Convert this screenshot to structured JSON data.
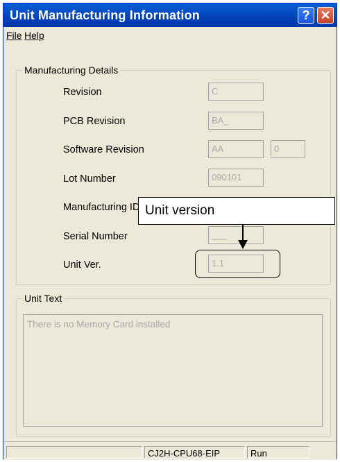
{
  "window": {
    "title": "Unit Manufacturing Information"
  },
  "title_buttons": {
    "help_glyph": "?",
    "close_glyph": "✕"
  },
  "menu": {
    "file": "File",
    "help": "Help"
  },
  "manufacturing_details": {
    "legend": "Manufacturing Details",
    "revision_label": "Revision",
    "revision_value": "C",
    "pcb_revision_label": "PCB Revision",
    "pcb_revision_value": "BA_",
    "software_revision_label": "Software Revision",
    "software_revision_value": "AA",
    "software_revision_value2": "0",
    "lot_number_label": "Lot Number",
    "lot_number_value": "090101",
    "manufacturing_id_label": "Manufacturing ID",
    "serial_number_label": "Serial Number",
    "serial_number_value": "___",
    "unit_ver_label": "Unit Ver.",
    "unit_ver_value": "1.1"
  },
  "unit_text": {
    "legend": "Unit Text",
    "content": "There is no Memory Card installed"
  },
  "statusbar": {
    "model": "CJ2H-CPU68-EIP",
    "mode": "Run"
  },
  "annotation": {
    "callout_text": "Unit version"
  }
}
